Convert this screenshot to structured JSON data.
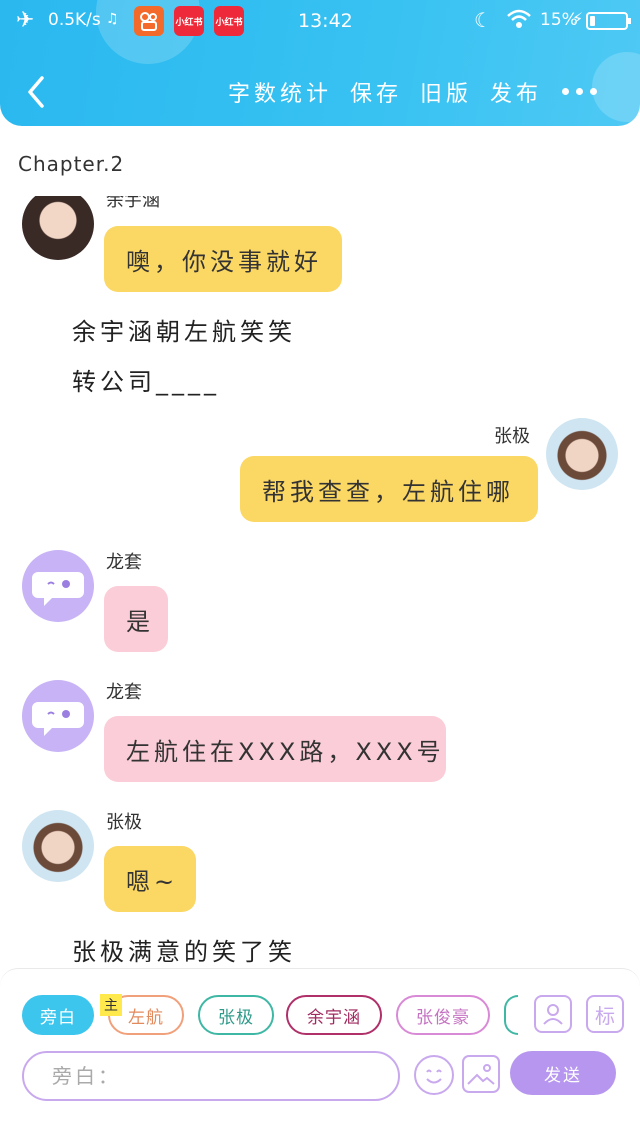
{
  "status_bar": {
    "speed": "0.5K/s",
    "time": "13:42",
    "battery": "15%",
    "battery_level": 0.15,
    "app_icons": [
      {
        "name": "kuaishou-icon",
        "color": "#f36a2a",
        "label": ""
      },
      {
        "name": "xiaohongshu-icon",
        "color": "#ee2a3a",
        "label": "小红书"
      },
      {
        "name": "xiaohongshu-icon",
        "color": "#ee2a3a",
        "label": "小红书"
      }
    ]
  },
  "toolbar": {
    "word_count": "字数统计",
    "save": "保存",
    "old_version": "旧版",
    "publish": "发布"
  },
  "chapter_title": "Chapter.2",
  "messages": [
    {
      "type": "left",
      "sender": "余宇涵",
      "text": "噢，你没事就好",
      "color": "yellow"
    },
    {
      "type": "narration",
      "text": "余宇涵朝左航笑笑"
    },
    {
      "type": "narration",
      "text": "转公司____"
    },
    {
      "type": "right",
      "sender": "张极",
      "text": "帮我查查，左航住哪",
      "color": "yellow"
    },
    {
      "type": "left",
      "sender": "龙套",
      "text": "是",
      "color": "pink"
    },
    {
      "type": "left",
      "sender": "龙套",
      "text": "左航住在XXX路，XXX号",
      "color": "pink"
    },
    {
      "type": "left",
      "sender": "张极",
      "text": "嗯~",
      "color": "yellow"
    },
    {
      "type": "narration",
      "text": "张极满意的笑了笑"
    }
  ],
  "roles": [
    {
      "label": "旁白",
      "color": "#3cc6ee",
      "active": true
    },
    {
      "label": "左航",
      "color": "#f0a07a",
      "active": false
    },
    {
      "label": "张极",
      "color": "#3fb7a5",
      "active": false
    },
    {
      "label": "余宇涵",
      "color": "#b0306a",
      "active": false
    },
    {
      "label": "张俊豪",
      "color": "#d98ad6",
      "active": false
    }
  ],
  "main_tag": "主",
  "mark_button": "标",
  "input": {
    "placeholder": "旁白："
  },
  "send_label": "发送",
  "colors": {
    "header": "#38c2f2",
    "yellow_bubble": "#fbd764",
    "pink_bubble": "#fbcdd8",
    "purple": "#b696ee"
  }
}
